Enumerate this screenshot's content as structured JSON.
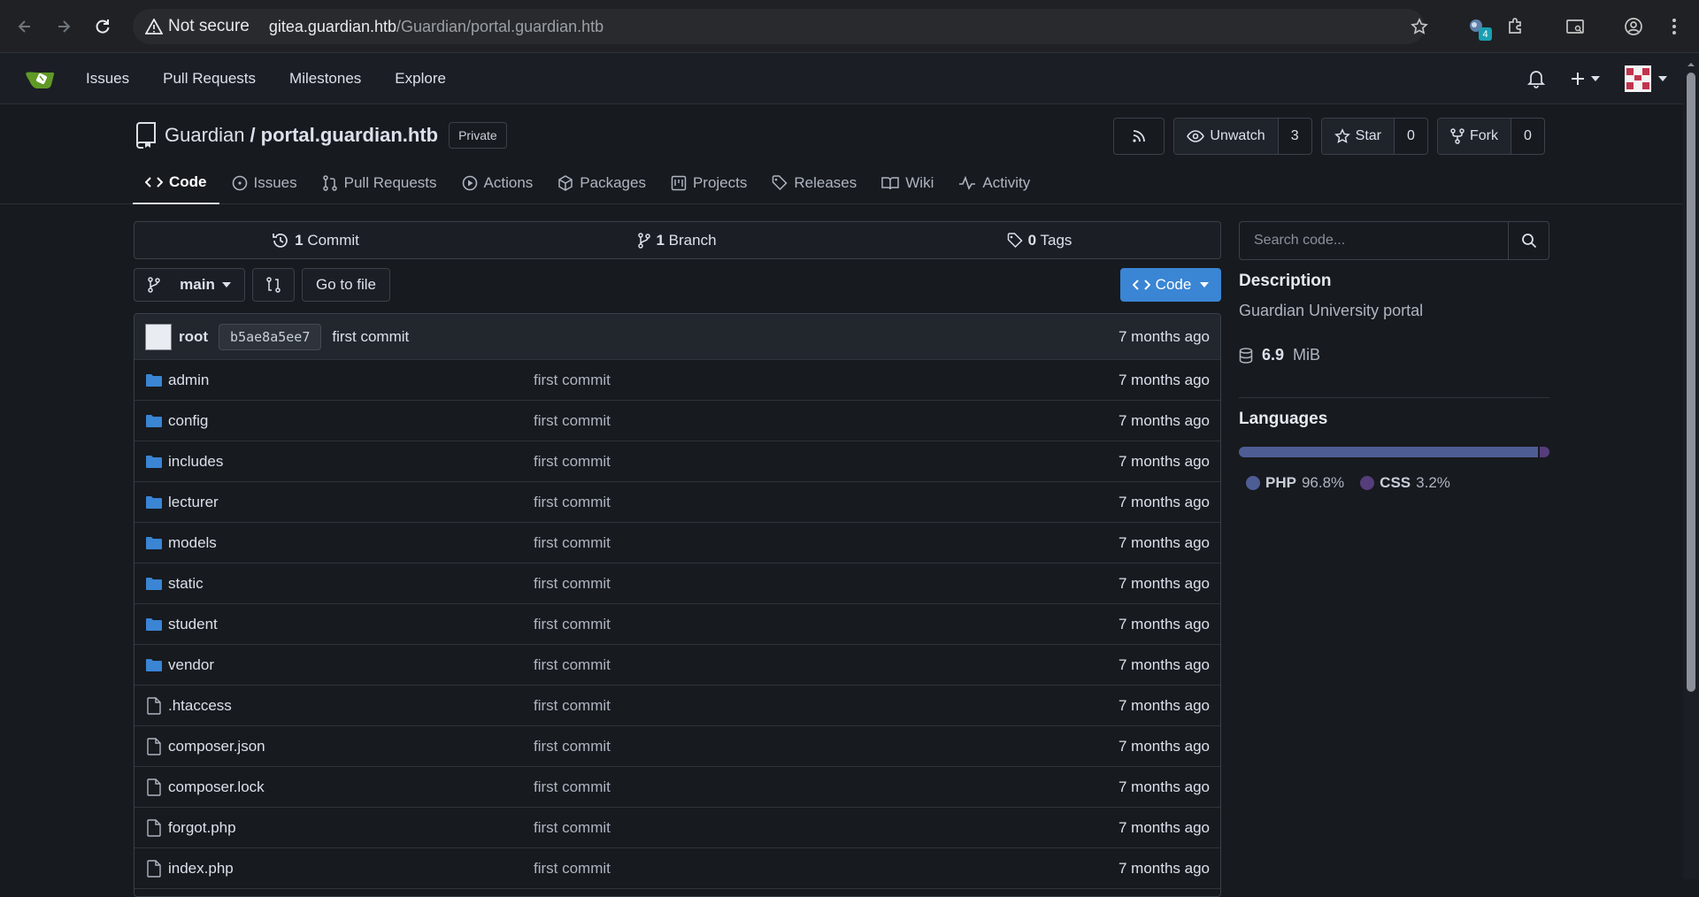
{
  "browser": {
    "security_label": "Not secure",
    "url_host": "gitea.guardian.htb",
    "url_path": "/Guardian/portal.guardian.htb",
    "extension_badge": "4"
  },
  "topnav": {
    "links": [
      "Issues",
      "Pull Requests",
      "Milestones",
      "Explore"
    ],
    "logo_color": "#609926"
  },
  "repo": {
    "owner": "Guardian",
    "separator": "/",
    "name": "portal.guardian.htb",
    "visibility": "Private",
    "watch": {
      "label": "Unwatch",
      "count": "3"
    },
    "star": {
      "label": "Star",
      "count": "0"
    },
    "fork": {
      "label": "Fork",
      "count": "0"
    }
  },
  "tabs": [
    {
      "label": "Code",
      "icon": "code-icon",
      "active": true
    },
    {
      "label": "Issues",
      "icon": "issue-icon"
    },
    {
      "label": "Pull Requests",
      "icon": "pull-request-icon"
    },
    {
      "label": "Actions",
      "icon": "play-icon"
    },
    {
      "label": "Packages",
      "icon": "package-icon"
    },
    {
      "label": "Projects",
      "icon": "project-icon"
    },
    {
      "label": "Releases",
      "icon": "tag-icon"
    },
    {
      "label": "Wiki",
      "icon": "book-icon"
    },
    {
      "label": "Activity",
      "icon": "pulse-icon"
    }
  ],
  "stats": {
    "commits": {
      "count": "1",
      "label": "Commit"
    },
    "branches": {
      "count": "1",
      "label": "Branch"
    },
    "tags": {
      "count": "0",
      "label": "Tags"
    }
  },
  "toolbar": {
    "branch": "main",
    "go_to_file": "Go to file",
    "code_button": "Code",
    "accent_color": "#3a85d4"
  },
  "latest_commit": {
    "author": "root",
    "sha": "b5ae8a5ee7",
    "message": "first commit",
    "when": "7 months ago"
  },
  "files": [
    {
      "name": "admin",
      "type": "dir",
      "message": "first commit",
      "when": "7 months ago"
    },
    {
      "name": "config",
      "type": "dir",
      "message": "first commit",
      "when": "7 months ago"
    },
    {
      "name": "includes",
      "type": "dir",
      "message": "first commit",
      "when": "7 months ago"
    },
    {
      "name": "lecturer",
      "type": "dir",
      "message": "first commit",
      "when": "7 months ago"
    },
    {
      "name": "models",
      "type": "dir",
      "message": "first commit",
      "when": "7 months ago"
    },
    {
      "name": "static",
      "type": "dir",
      "message": "first commit",
      "when": "7 months ago"
    },
    {
      "name": "student",
      "type": "dir",
      "message": "first commit",
      "when": "7 months ago"
    },
    {
      "name": "vendor",
      "type": "dir",
      "message": "first commit",
      "when": "7 months ago"
    },
    {
      "name": ".htaccess",
      "type": "file",
      "message": "first commit",
      "when": "7 months ago"
    },
    {
      "name": "composer.json",
      "type": "file",
      "message": "first commit",
      "when": "7 months ago"
    },
    {
      "name": "composer.lock",
      "type": "file",
      "message": "first commit",
      "when": "7 months ago"
    },
    {
      "name": "forgot.php",
      "type": "file",
      "message": "first commit",
      "when": "7 months ago"
    },
    {
      "name": "index.php",
      "type": "file",
      "message": "first commit",
      "when": "7 months ago"
    }
  ],
  "sidebar": {
    "search_placeholder": "Search code...",
    "description_heading": "Description",
    "description": "Guardian University portal",
    "size_value": "6.9",
    "size_unit": "MiB",
    "languages_heading": "Languages",
    "languages": [
      {
        "name": "PHP",
        "percent": "96.8%",
        "share": 96.8,
        "color": "#4f5d95"
      },
      {
        "name": "CSS",
        "percent": "3.2%",
        "share": 3.2,
        "color": "#563d7c"
      }
    ]
  }
}
